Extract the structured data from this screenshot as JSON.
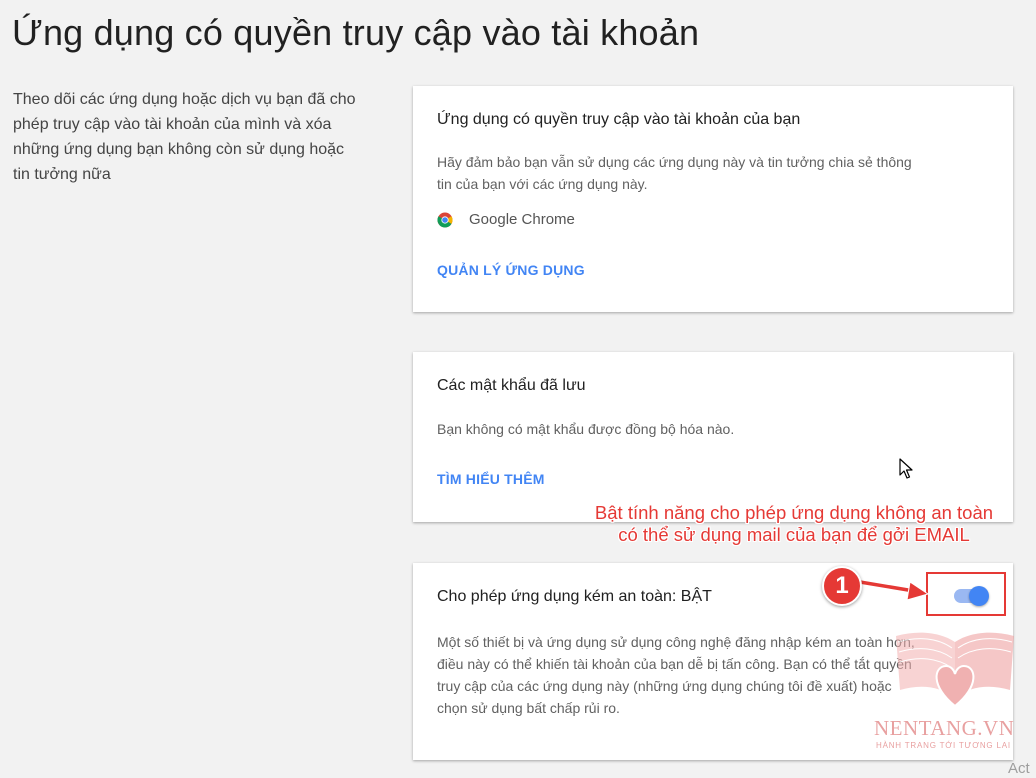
{
  "page": {
    "title": "Ứng dụng có quyền truy cập vào tài khoản",
    "description": "Theo dõi các ứng dụng hoặc dịch vụ bạn đã cho phép truy cập vào tài khoản của mình và xóa những ứng dụng bạn không còn sử dụng hoặc tin tưởng nữa"
  },
  "apps_card": {
    "title": "Ứng dụng có quyền truy cập vào tài khoản của bạn",
    "text": "Hãy đảm bảo bạn vẫn sử dụng các ứng dụng này và tin tưởng chia sẻ thông tin của bạn với các ứng dụng này.",
    "app_name": "Google Chrome",
    "app_icon": "chrome-icon",
    "link": "QUẢN LÝ ỨNG DỤNG"
  },
  "passwords_card": {
    "title": "Các mật khẩu đã lưu",
    "text": "Bạn không có mật khẩu được đồng bộ hóa nào.",
    "link": "TÌM HIỂU THÊM"
  },
  "less_secure_card": {
    "title": "Cho phép ứng dụng kém an toàn: BẬT",
    "text": "Một số thiết bị và ứng dụng sử dụng công nghệ đăng nhập kém an toàn hơn, điều này có thể khiến tài khoản của bạn dễ bị tấn công. Bạn có thể tắt quyền truy cập của các ứng dụng này (những ứng dụng chúng tôi đề xuất) hoặc chọn sử dụng bất chấp rủi ro.",
    "toggle_on": true
  },
  "annotation": {
    "text": "Bật tính năng cho phép ứng dụng không an toàn có thể sử dụng mail của bạn để gởi EMAIL",
    "step": "1"
  },
  "watermark": {
    "name": "NENTANG.VN",
    "slogan": "HÀNH TRANG TỚI TƯƠNG LAI"
  },
  "corner_text": "Act",
  "colors": {
    "accent": "#4285f4",
    "annotation": "#e53935",
    "background": "#f2f2f2"
  }
}
